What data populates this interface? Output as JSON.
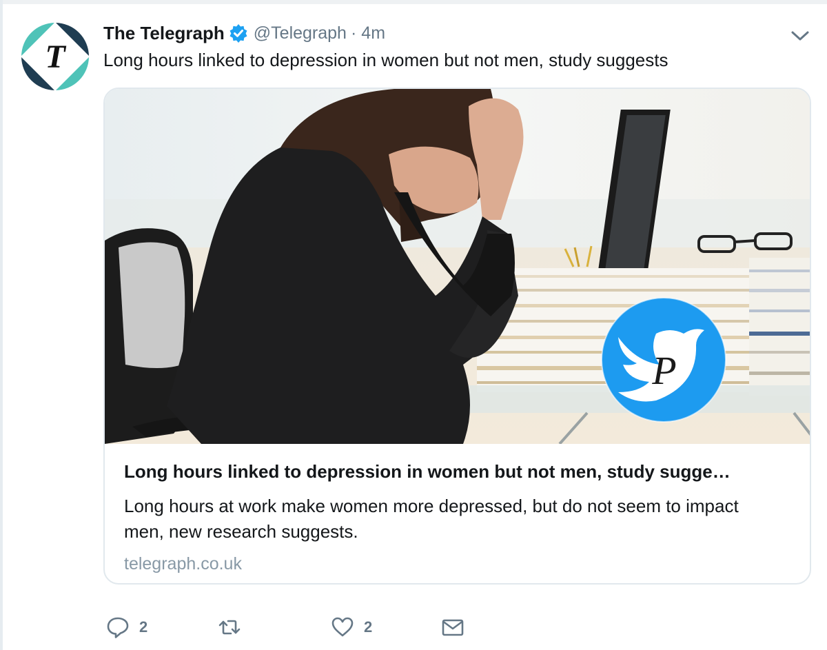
{
  "tweet": {
    "author_name": "The Telegraph",
    "handle": "@Telegraph",
    "separator": "·",
    "time": "4m",
    "text": "Long hours linked to depression in women but not men, study suggests",
    "avatar_letter": "T"
  },
  "card": {
    "title": "Long hours linked to depression in women but not men, study sugge…",
    "description": "Long hours at work make women more depressed, but do not seem to impact men, new research suggests.",
    "domain": "telegraph.co.uk",
    "watermark_letter": "P"
  },
  "actions": {
    "reply_count": "2",
    "retweet_count": "",
    "like_count": "2"
  },
  "icons": {
    "verified": "verified-badge-icon",
    "caret": "chevron-down-icon",
    "reply": "reply-icon",
    "retweet": "retweet-icon",
    "like": "heart-icon",
    "message": "envelope-icon"
  },
  "colors": {
    "verified_blue": "#1da1f2",
    "text_gray": "#657786",
    "link_gray": "#8899a6",
    "avatar_teal": "#4fc3b8",
    "avatar_navy": "#1f3d52"
  }
}
